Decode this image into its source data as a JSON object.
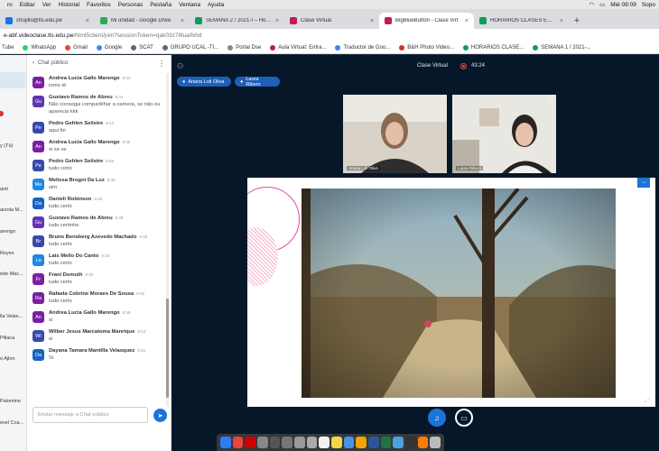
{
  "menubar": {
    "items": [
      "ro",
      "Editar",
      "Ver",
      "Historial",
      "Favoritos",
      "Personas",
      "Pestaña",
      "Ventana",
      "Ayuda"
    ],
    "clock": "Mié 09:09",
    "user": "Sopo"
  },
  "tabs": [
    {
      "title": "ctrujillo@tls.edu.pe",
      "color": "#1a73e8"
    },
    {
      "title": "Mi unidad - Google Drive",
      "color": "#34a853"
    },
    {
      "title": "SEMANA 2 / 2021-I – Hojas de",
      "color": "#0f9d58"
    },
    {
      "title": "Clase Virtual",
      "color": "#c2185b"
    },
    {
      "title": "BigBlueButton - Clase Virt",
      "color": "#c2185b"
    },
    {
      "title": "HORARIOS CLASES EN SEGU",
      "color": "#0f9d58"
    }
  ],
  "address": {
    "host": "e-abf.videoclase.tls.edu.pe",
    "path": "/html5client/join?sessionToken=qak03z78luaifxhd"
  },
  "bookmarks": [
    "Tube",
    "WhatsApp",
    "Gmail",
    "Google",
    "SCAT",
    "GRUPO UCAL -TI...",
    "Portal Dse",
    "Aula Virtual: Entra...",
    "Traductor de Goo...",
    "B&H Photo Video...",
    "HORARIOS CLASE...",
    "SEMANA 1 / 2021-..."
  ],
  "userlist": [
    "y (Tú)",
    "anti",
    "arzola M...",
    "arengo",
    "Reyes",
    "edo Mac...",
    "lla Velas...",
    "Pillaca",
    "o Ajlon",
    "Palomino",
    "evel Cca..."
  ],
  "chat": {
    "header": "Chat público",
    "input_placeholder": "Enviar mensaje a Chat público",
    "messages": [
      {
        "initials": "An",
        "color": "#7b1fa2",
        "name": "Andrea Lucia Gallo Marengo",
        "time": "8:43",
        "text": "tomo té"
      },
      {
        "initials": "Gu",
        "color": "#5e35b1",
        "name": "Gustavo Ramos de Abreu",
        "time": "8:44",
        "text": "Não consegui compartilhar a camera, se não eu aparecia kkk"
      },
      {
        "initials": "Pe",
        "color": "#3949ab",
        "name": "Pedro Gehlen Seilstre",
        "time": "8:44",
        "text": "aqui foi"
      },
      {
        "initials": "An",
        "color": "#7b1fa2",
        "name": "Andrea Lucia Gallo Marengo",
        "time": "8:46",
        "text": "si se ve"
      },
      {
        "initials": "Pe",
        "color": "#3949ab",
        "name": "Pedro Gehlen Seilstre",
        "time": "8:48",
        "text": "tudo certo"
      },
      {
        "initials": "Me",
        "color": "#1e88e5",
        "name": "Melissa Brogni Da Luz",
        "time": "8:48",
        "text": "sim"
      },
      {
        "initials": "Da",
        "color": "#1565c0",
        "name": "Danieli Robinson",
        "time": "8:48",
        "text": "tudo certo"
      },
      {
        "initials": "Gu",
        "color": "#5e35b1",
        "name": "Gustavo Ramos de Abreu",
        "time": "8:49",
        "text": "tudo certinho"
      },
      {
        "initials": "Br",
        "color": "#3949ab",
        "name": "Bruno Bensberg Azevedo Machado",
        "time": "8:49",
        "text": "tudo certo"
      },
      {
        "initials": "La",
        "color": "#1e88e5",
        "name": "Lais Mello Do Canto",
        "time": "8:49",
        "text": "tudo certo"
      },
      {
        "initials": "Fr",
        "color": "#7b1fa2",
        "name": "Frani Demuth",
        "time": "8:49",
        "text": "tudo certo"
      },
      {
        "initials": "Ra",
        "color": "#7b1fa2",
        "name": "Rafaela Cobrine Moraes De Sousa",
        "time": "8:49",
        "text": "tudo certo"
      },
      {
        "initials": "An",
        "color": "#7b1fa2",
        "name": "Andrea Lucia Gallo Marengo",
        "time": "8:49",
        "text": "si"
      },
      {
        "initials": "Wi",
        "color": "#3949ab",
        "name": "Wilber Jesus Marcatoma Manrique",
        "time": "8:53",
        "text": "si"
      },
      {
        "initials": "Da",
        "color": "#1565c0",
        "name": "Dayana Tamara Mantilla Velasquez",
        "time": "9:03",
        "text": "Si"
      }
    ]
  },
  "main": {
    "title": "Clase Virtual",
    "timer": "43:24",
    "talkers": [
      "Ariana Loli Oliva",
      "Laura Ribero"
    ],
    "webcams": [
      "Ariana Loli Oliva",
      "Laura Ribero"
    ]
  }
}
